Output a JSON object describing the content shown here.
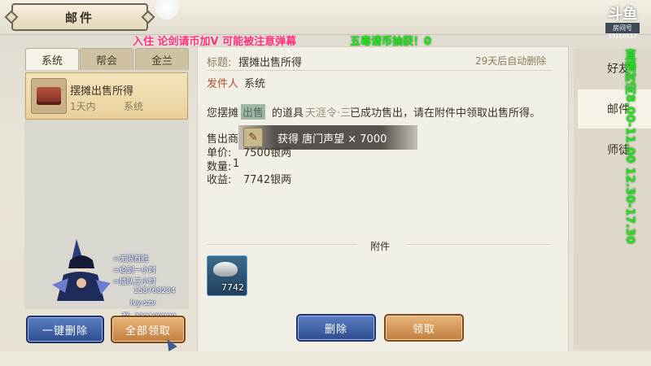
{
  "window": {
    "title": "邮件"
  },
  "overlay": {
    "promo_text": "入住 论剑请币加V  可能被注意弹幕",
    "green_text": "五毒请币抽获！0",
    "schedule": "直播时间8.00-11.00  12.30-17.30"
  },
  "logo": {
    "mark": "斗鱼",
    "sub": "房间号",
    "id": "37150517"
  },
  "tabs": [
    {
      "label": "系统"
    },
    {
      "label": "帮会"
    },
    {
      "label": "金兰"
    }
  ],
  "mail_list": [
    {
      "title": "摆摊出售所得",
      "time": "1天内",
      "sender": "系统"
    }
  ],
  "mail_detail": {
    "subject_label": "标题:",
    "subject": "摆摊出售所得",
    "expiry": "29天后自动删除",
    "sender_label": "发件人",
    "sender": "系统",
    "body_start": "您摆摊",
    "body_item": "的道具",
    "body_tail": "已成功售出，请在附件中领取出售所得。",
    "body_hidden_1": "出售",
    "body_hidden_2": "天涯令·三",
    "price_label": "单价:",
    "price_value": "7500银两",
    "sale_label": "售出商",
    "qty_label": "数量:",
    "qty_value": "1",
    "income_label": "收益:",
    "income_value": "7742银两",
    "attachment_label": "附件",
    "attachment_count": "7742"
  },
  "toast": {
    "text": "获得 唐门声望 × 7000"
  },
  "buttons": {
    "delete_all": "一键删除",
    "claim_all": "全部领取",
    "delete": "删除",
    "claim": "领取"
  },
  "side_nav": [
    {
      "label": "好友"
    },
    {
      "label": "邮件"
    },
    {
      "label": "师徒"
    }
  ],
  "streamer_chat": [
    {
      "text": "=无限首胜"
    },
    {
      "text": "=论剑一小时"
    },
    {
      "text": "=插队三小时"
    },
    {
      "text": "158768234"
    },
    {
      "text": "Ivy-szv"
    },
    {
      "text": "群: 732189233"
    }
  ],
  "colors": {
    "accent_blue": "#2e4c8e",
    "accent_gold": "#c27d3e",
    "overlay_red": "#ff2f7a",
    "overlay_green": "#22e21e"
  }
}
